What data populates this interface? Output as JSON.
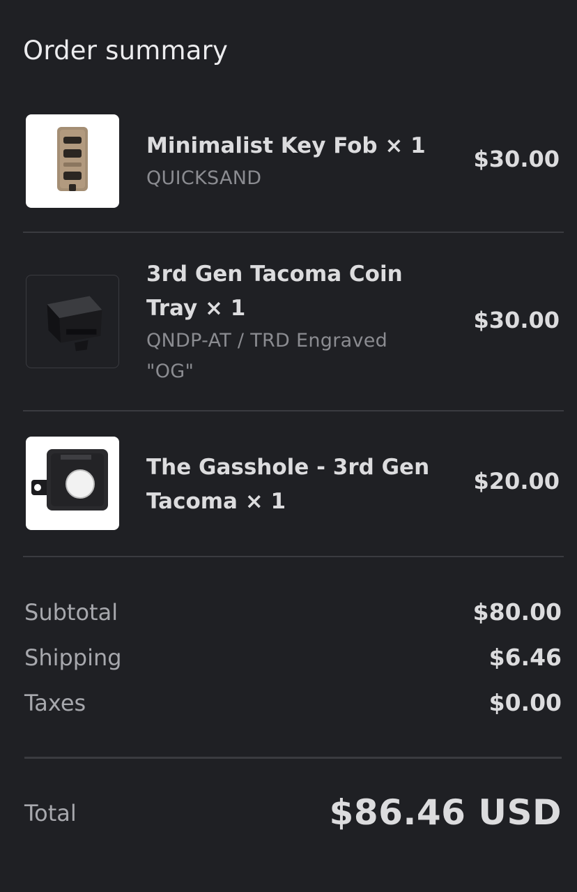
{
  "header": {
    "title": "Order summary"
  },
  "items": [
    {
      "name": "Minimalist Key Fob × 1",
      "variant": "QUICKSAND",
      "price": "$30.00",
      "image": "key-fob-product-image"
    },
    {
      "name": "3rd Gen Tacoma Coin Tray × 1",
      "variant": "QNDP-AT / TRD Engraved \"OG\"",
      "price": "$30.00",
      "image": "coin-tray-product-image"
    },
    {
      "name": "The Gasshole - 3rd Gen Tacoma × 1",
      "variant": "",
      "price": "$20.00",
      "image": "gas-door-product-image"
    }
  ],
  "summary": {
    "subtotal_label": "Subtotal",
    "subtotal_value": "$80.00",
    "shipping_label": "Shipping",
    "shipping_value": "$6.46",
    "taxes_label": "Taxes",
    "taxes_value": "$0.00"
  },
  "total": {
    "label": "Total",
    "value": "$86.46 USD"
  },
  "colors": {
    "background": "#1f2024",
    "divider": "#3a3b40",
    "primary_text": "#dcdcde",
    "secondary_text": "#8b8c91"
  }
}
